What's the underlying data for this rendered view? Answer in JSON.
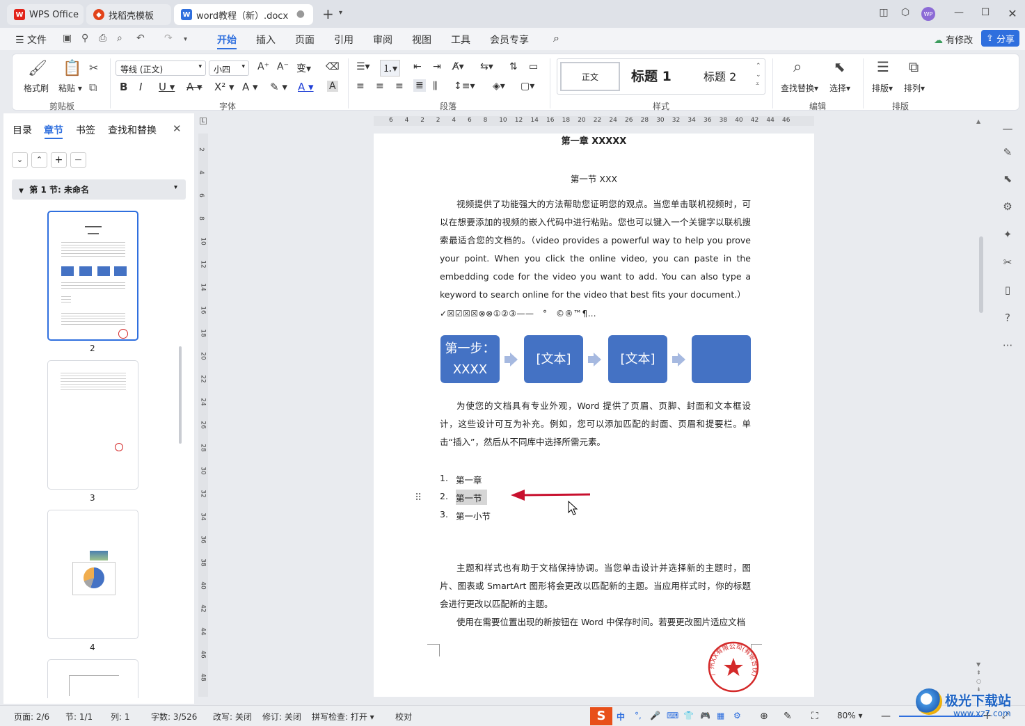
{
  "tabs": {
    "wps": "WPS Office",
    "template": "找稻壳模板",
    "doc": "word教程（新）.docx"
  },
  "menu": {
    "file": "文件",
    "items": [
      "开始",
      "插入",
      "页面",
      "引用",
      "审阅",
      "视图",
      "工具",
      "会员专享"
    ],
    "modified": "有修改",
    "share": "分享",
    "avatar": "WP"
  },
  "ribbon": {
    "format_painter": "格式刷",
    "paste": "粘贴",
    "font_name": "等线 (正文)",
    "font_size": "小四",
    "styles": [
      "正文",
      "标题 1",
      "标题 2"
    ],
    "find_replace": "查找替换",
    "select": "选择",
    "layout": "排版",
    "arrange": "排列",
    "groups": [
      "剪贴板",
      "字体",
      "段落",
      "样式",
      "编辑",
      "排版"
    ]
  },
  "nav": {
    "tabs": [
      "目录",
      "章节",
      "书签",
      "查找和替换"
    ],
    "active_tab": "章节",
    "section": "第 1 节: 未命名",
    "pages": [
      "2",
      "3",
      "4"
    ]
  },
  "ruler": {
    "h": [
      "6",
      "4",
      "2",
      "2",
      "4",
      "6",
      "8",
      "10",
      "12",
      "14",
      "16",
      "18",
      "20",
      "22",
      "24",
      "26",
      "28",
      "30",
      "32",
      "34",
      "36",
      "38",
      "40",
      "42",
      "44",
      "46"
    ],
    "v": [
      "2",
      "4",
      "6",
      "8",
      "10",
      "12",
      "14",
      "16",
      "18",
      "20",
      "22",
      "24",
      "26",
      "28",
      "30",
      "32",
      "34",
      "36",
      "38",
      "40",
      "42",
      "44",
      "46",
      "48"
    ]
  },
  "document": {
    "chapter": "第一章  XXXXX",
    "section": "第一节  XXX",
    "p1": "视频提供了功能强大的方法帮助您证明您的观点。当您单击联机视频时，可以在想要添加的视频的嵌入代码中进行粘贴。您也可以键入一个关键字以联机搜索最适合您的文档的。（video provides a powerful way to help you prove your point. When you click the online video, you can paste in the embedding code for the video you want to add. You can also type a keyword to search online for the video that best fits your document.）",
    "symbols": "✓☒☑☒☒⊗⊗①②③——　°　©®™¶…",
    "flow": [
      "第一步：XXXX",
      "[文本]",
      "[文本]",
      ""
    ],
    "p2": "为使您的文档具有专业外观，Word 提供了页眉、页脚、封面和文本框设计，这些设计可互为补充。例如，您可以添加匹配的封面、页眉和提要栏。单击“插入”，然后从不同库中选择所需元素。",
    "list": [
      {
        "num": "1.",
        "text": "第一章"
      },
      {
        "num": "2.",
        "text": "第一节"
      },
      {
        "num": "3.",
        "text": "第一小节"
      }
    ],
    "p3": "主题和样式也有助于文档保持协调。当您单击设计并选择新的主题时，图片、图表或 SmartArt 图形将会更改以匹配新的主题。当应用样式时，你的标题会进行更改以匹配新的主题。",
    "p4": "使用在需要位置出现的新按钮在 Word 中保存时间。若要更改图片适应文档",
    "stamp": "广州XX有限公司(有限合伙)"
  },
  "status": {
    "page": "页面: 2/6",
    "section": "节: 1/1",
    "col": "列: 1",
    "words": "字数: 3/526",
    "rewrite": "改写: 关闭",
    "revise": "修订: 关闭",
    "spell": "拼写检查: 打开",
    "proof": "校对",
    "zoom": "80%",
    "ime": "中"
  },
  "watermark": {
    "site": "极光下载站",
    "url": "www.xz7.com"
  },
  "colors": {
    "accent": "#2f6fde",
    "flow": "#4472c4",
    "arrow": "#c8102e",
    "stamp": "#d42a2a"
  }
}
